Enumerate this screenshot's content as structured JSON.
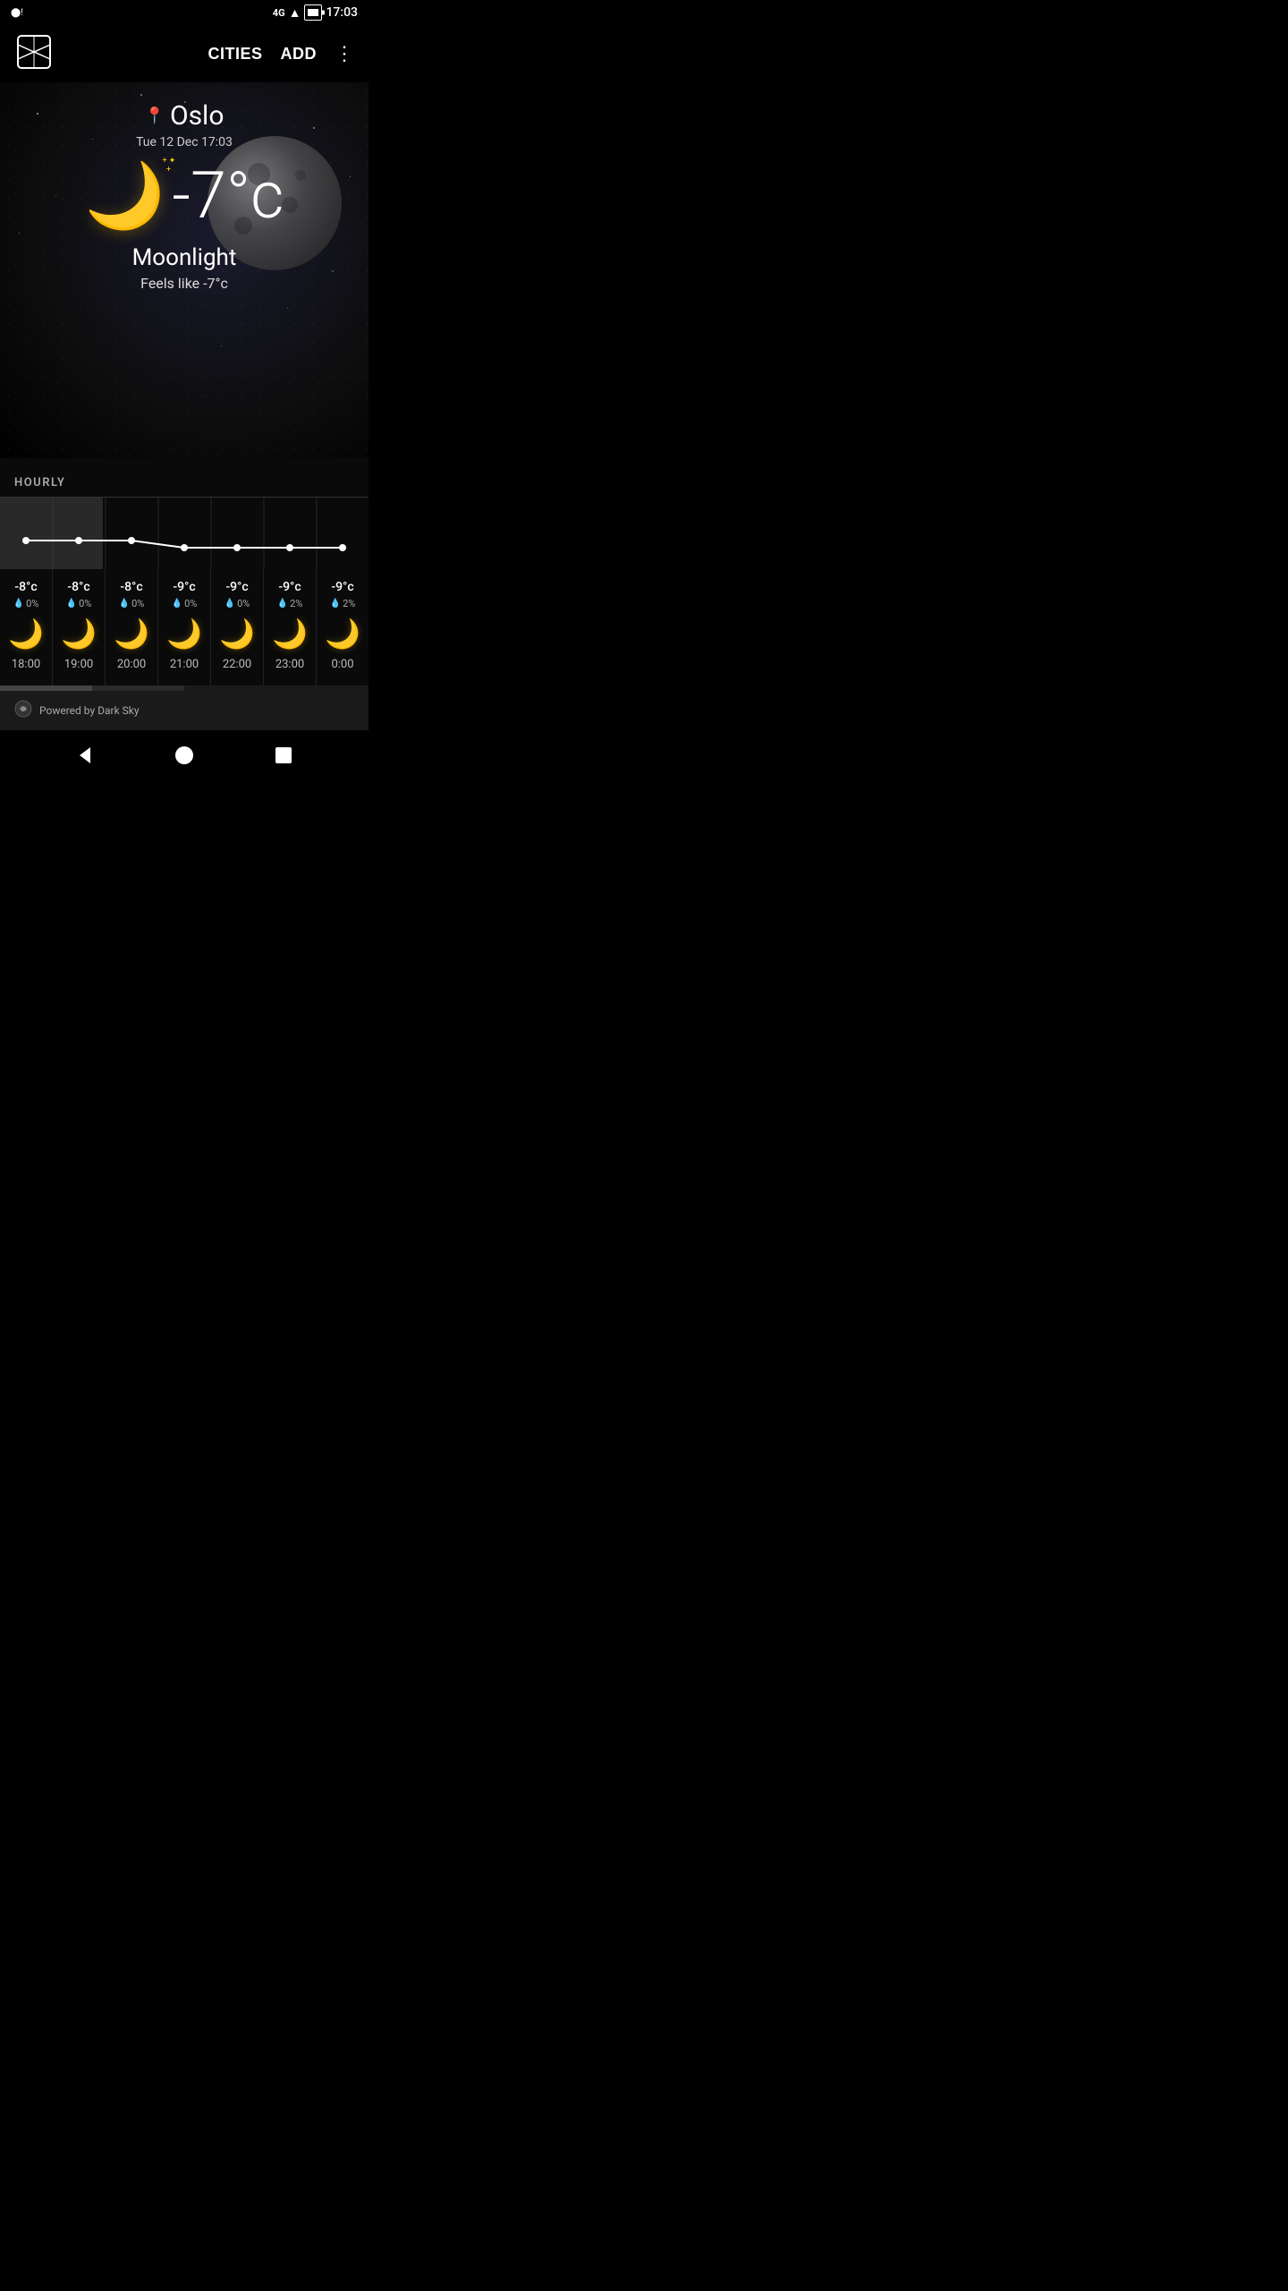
{
  "statusBar": {
    "time": "17:03",
    "network": "4G",
    "battery": "charging"
  },
  "nav": {
    "citiesLabel": "CITIES",
    "addLabel": "ADD",
    "moreLabel": "⋮"
  },
  "weather": {
    "city": "Oslo",
    "dateTime": "Tue 12 Dec 17:03",
    "temperature": "-7°c",
    "description": "Moonlight",
    "feelsLike": "Feels like -7°c"
  },
  "hourly": {
    "sectionLabel": "HOURLY",
    "cards": [
      {
        "time": "18:00",
        "temp": "-8°c",
        "precip": "0%",
        "icon": "🌙"
      },
      {
        "time": "19:00",
        "temp": "-8°c",
        "precip": "0%",
        "icon": "🌙"
      },
      {
        "time": "20:00",
        "temp": "-8°c",
        "precip": "0%",
        "icon": "🌙"
      },
      {
        "time": "21:00",
        "temp": "-9°c",
        "precip": "0%",
        "icon": "🌙"
      },
      {
        "time": "22:00",
        "temp": "-9°c",
        "precip": "0%",
        "icon": "🌙"
      },
      {
        "time": "23:00",
        "temp": "-9°c",
        "precip": "2%",
        "icon": "🌙"
      },
      {
        "time": "0:00",
        "temp": "-9°c",
        "precip": "2%",
        "icon": "🌙"
      }
    ]
  },
  "footer": {
    "poweredBy": "Powered by Dark Sky"
  },
  "icons": {
    "location": "📍",
    "droplet": "💧",
    "backArrow": "◀",
    "homeCircle": "●",
    "recentSquare": "■"
  }
}
